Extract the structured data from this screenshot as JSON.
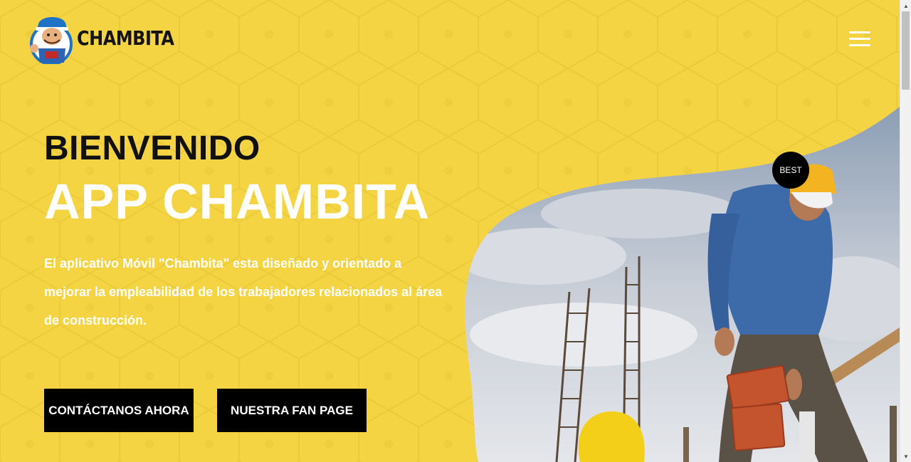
{
  "brand": {
    "name": "CHAMBITA"
  },
  "hero": {
    "title_line1": "BIENVENIDO",
    "title_line2": "APP CHAMBITA",
    "description": "El aplicativo Móvil \"Chambita\" esta diseñado y orientado a mejorar la empleabilidad de los trabajadores relacionados al área de construcción.",
    "badge": "BEST"
  },
  "buttons": {
    "contact_label": "CONTÁCTANOS AHORA",
    "fanpage_label": "NUESTRA FAN PAGE"
  },
  "icons": {
    "menu": "hamburger-menu-icon",
    "logo": "worker-mascot-icon",
    "scroll_up": "triangle-up-icon",
    "scroll_down": "triangle-down-icon"
  },
  "colors": {
    "background": "#f4d443",
    "button": "#000000",
    "title_dark": "#111111",
    "title_light": "#ffffff"
  }
}
